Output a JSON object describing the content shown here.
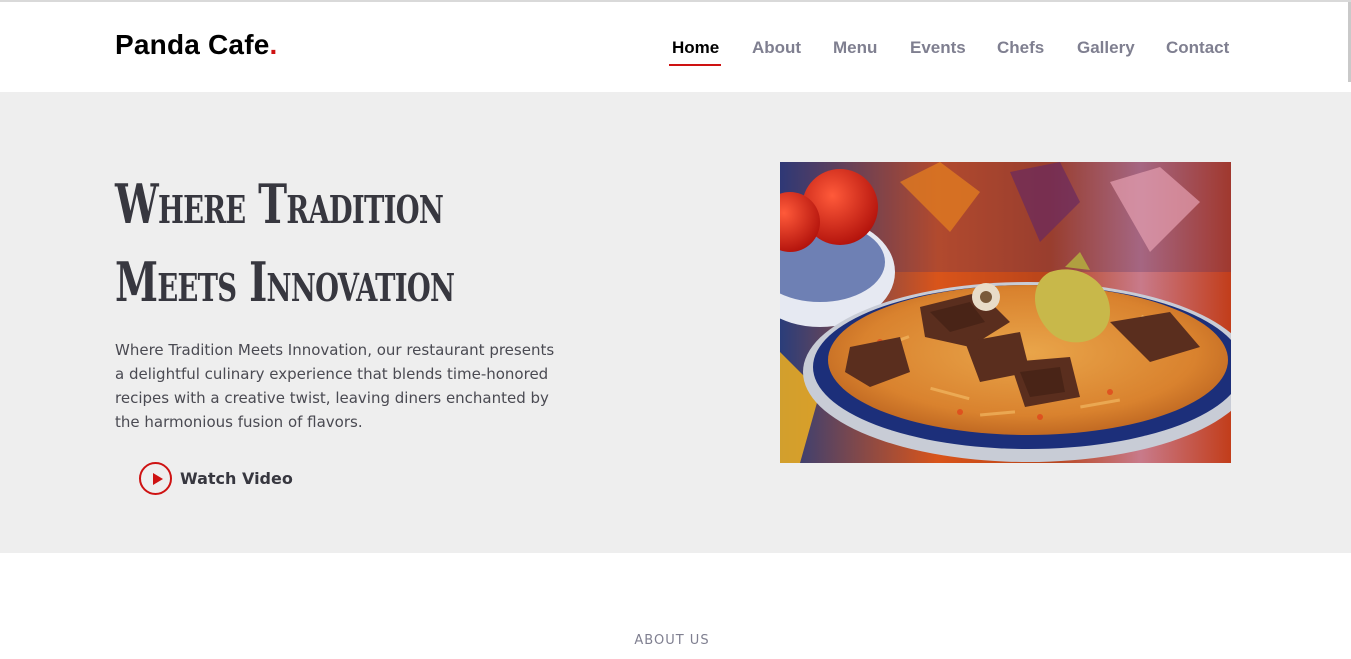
{
  "header": {
    "logo_text": "Panda Cafe",
    "logo_dot": ".",
    "nav": [
      {
        "label": "Home",
        "active": true
      },
      {
        "label": "About",
        "active": false
      },
      {
        "label": "Menu",
        "active": false
      },
      {
        "label": "Events",
        "active": false
      },
      {
        "label": "Chefs",
        "active": false
      },
      {
        "label": "Gallery",
        "active": false
      },
      {
        "label": "Contact",
        "active": false
      }
    ]
  },
  "hero": {
    "title_line1": "Where Tradition",
    "title_line2": "Meets Innovation",
    "description": "Where Tradition Meets Innovation, our restaurant presents a delightful culinary experience that blends time-honored recipes with a creative twist, leaving diners enchanted by the harmonious fusion of flavors.",
    "watch_video_label": "Watch Video",
    "image_icon": "plov-dish-photo"
  },
  "about": {
    "section_label": "ABOUT US"
  },
  "colors": {
    "accent": "#ce1212",
    "hero_bg": "#eeeeee",
    "heading": "#37373f",
    "nav_text": "#7f7f90"
  }
}
